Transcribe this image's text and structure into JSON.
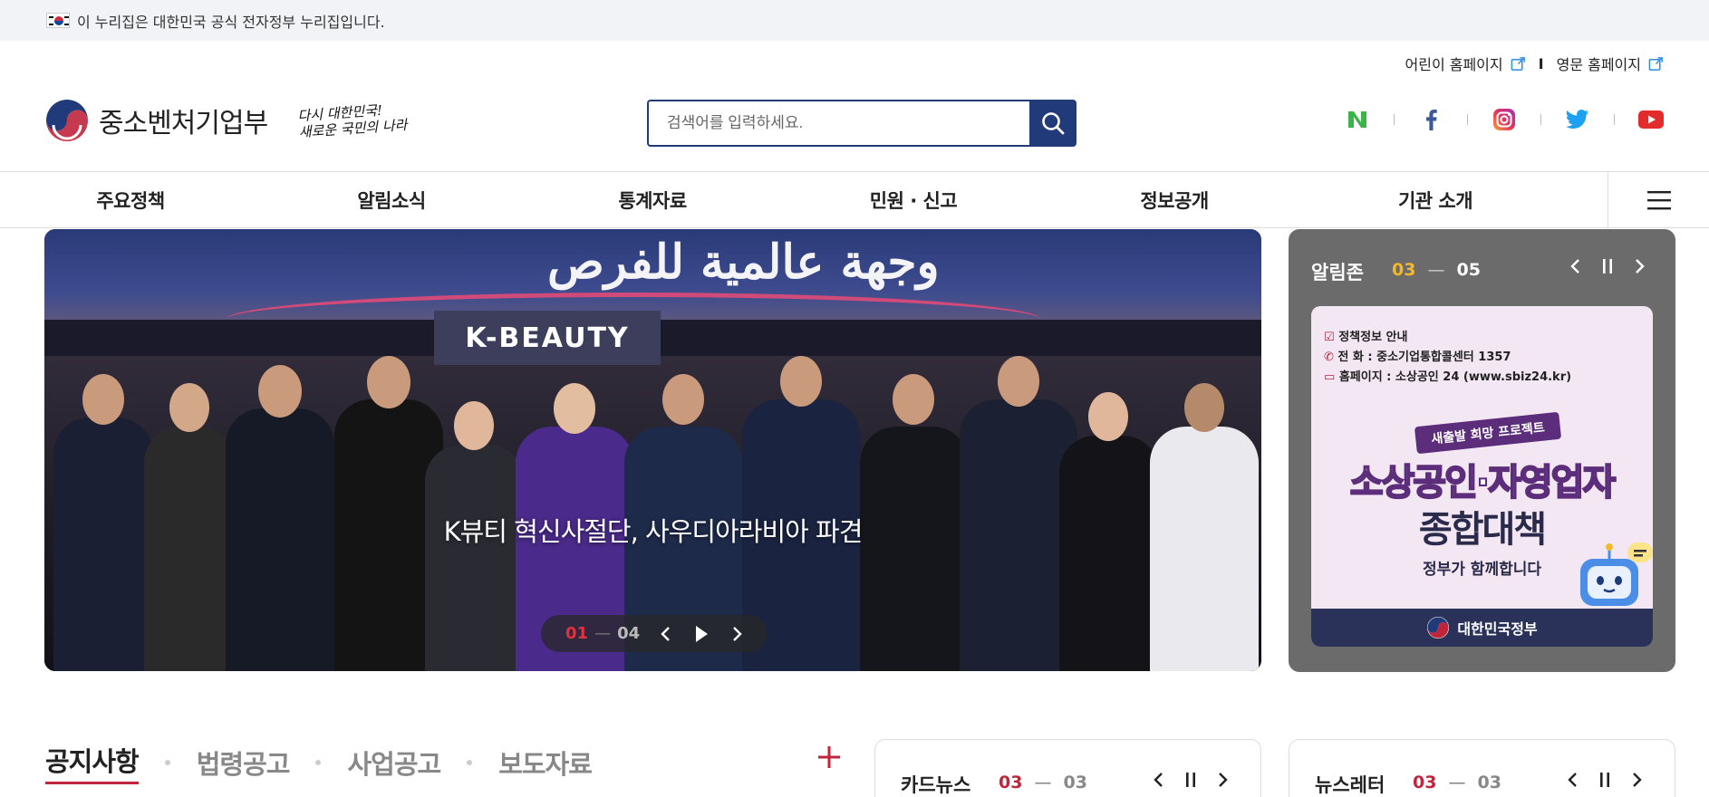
{
  "gov_banner": {
    "text": "이 누리집은 대한민국 공식 전자정부 누리집입니다."
  },
  "util_links": {
    "kids": "어린이 홈페이지",
    "sep": "I",
    "english": "영문 홈페이지"
  },
  "logo": {
    "name": "중소벤처기업부",
    "slogan_line1": "다시 대한민국!",
    "slogan_line2": "새로운 국민의 나라"
  },
  "search": {
    "placeholder": "검색어를 입력하세요."
  },
  "social": {
    "items": [
      "naver-blog-icon",
      "facebook-icon",
      "instagram-icon",
      "twitter-icon",
      "youtube-icon"
    ]
  },
  "nav": {
    "items": [
      "주요정책",
      "알림소식",
      "통계자료",
      "민원 · 신고",
      "정보공개",
      "기관 소개"
    ]
  },
  "hero": {
    "arabic_sign": "وجهة عالمية للفرص",
    "booth_sign": "K-BEAUTY",
    "caption": "K뷰티 혁신사절단, 사우디아라비아 파견",
    "current": "01",
    "total": "04"
  },
  "alarm_zone": {
    "title": "알림존",
    "current": "03",
    "total": "05",
    "poster": {
      "info_title": "정책정보 안내",
      "info_phone": "전     화 : 중소기업통합콜센터 1357",
      "info_web": "홈페이지 : 소상공인 24 (www.sbiz24.kr)",
      "ribbon": "새출발 희망 프로젝트",
      "headline1": "소상공인·자영업자",
      "headline2": "종합대책",
      "sub": "정부가 함께합니다",
      "footer": "대한민국정부"
    }
  },
  "notice": {
    "tabs": [
      "공지사항",
      "법령공고",
      "사업공고",
      "보도자료"
    ]
  },
  "card_news": {
    "title": "카드뉴스",
    "current": "03",
    "total": "03"
  },
  "newsletter": {
    "title": "뉴스레터",
    "current": "03",
    "total": "03"
  },
  "colors": {
    "brand_navy": "#203a7a",
    "accent_red": "#c0253c",
    "alarm_bg": "#6b6b6b",
    "alarm_yellow": "#f3b92c"
  }
}
